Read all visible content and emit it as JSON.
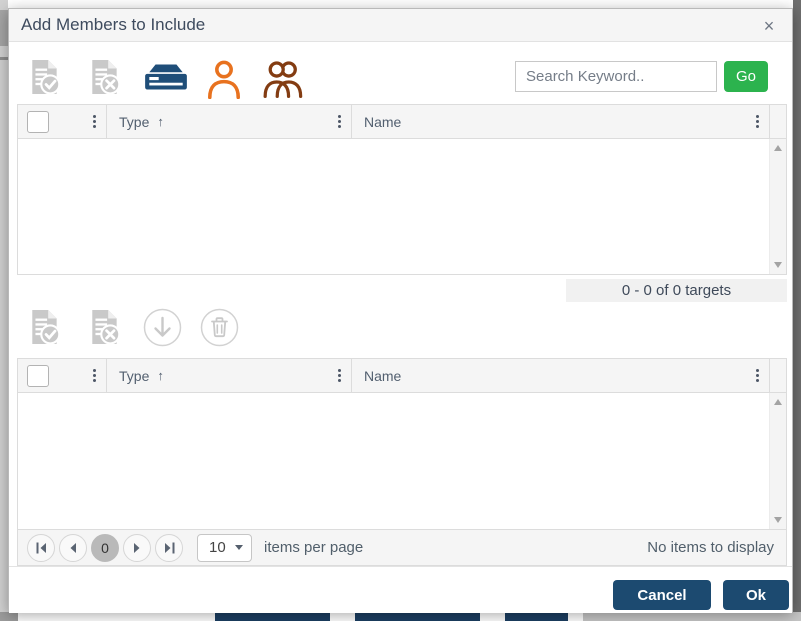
{
  "dialog": {
    "title": "Add Members to Include",
    "close_symbol": "×"
  },
  "toolbar_top": {
    "search_placeholder": "Search Keyword..",
    "go_label": "Go"
  },
  "tables": {
    "available": {
      "columns": {
        "type": "Type",
        "name": "Name"
      },
      "sort_indicator": "↑",
      "rows": [],
      "status": "0 - 0 of 0 targets"
    },
    "selected": {
      "columns": {
        "type": "Type",
        "name": "Name"
      },
      "sort_indicator": "↑",
      "rows": []
    }
  },
  "pager": {
    "current_page": "0",
    "page_size": "10",
    "items_per_page_label": "items per page",
    "empty_message": "No items to display"
  },
  "footer": {
    "cancel_label": "Cancel",
    "ok_label": "Ok"
  },
  "colors": {
    "go_green": "#2cb34e",
    "button_navy": "#1c4a70",
    "server_icon_blue": "#1f4e79",
    "person_icon_orange": "#e8721f",
    "group_icon_maroon": "#833c12",
    "disabled_icon_gray": "#c9c9c9",
    "header_bg": "#f5f5f5"
  }
}
